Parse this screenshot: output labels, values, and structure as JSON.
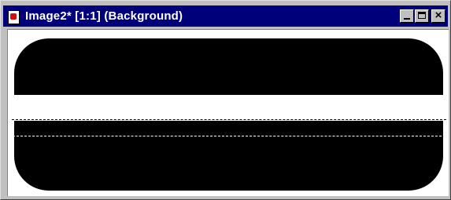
{
  "window": {
    "title": "Image2* [1:1] (Background)",
    "titlebar_color": "#00007b",
    "buttons": {
      "minimize": "minimize",
      "maximize": "maximize",
      "close_glyph": "×"
    }
  },
  "canvas": {
    "background": "#ffffff",
    "shape_color": "#000000",
    "selection": "marching-ants"
  }
}
